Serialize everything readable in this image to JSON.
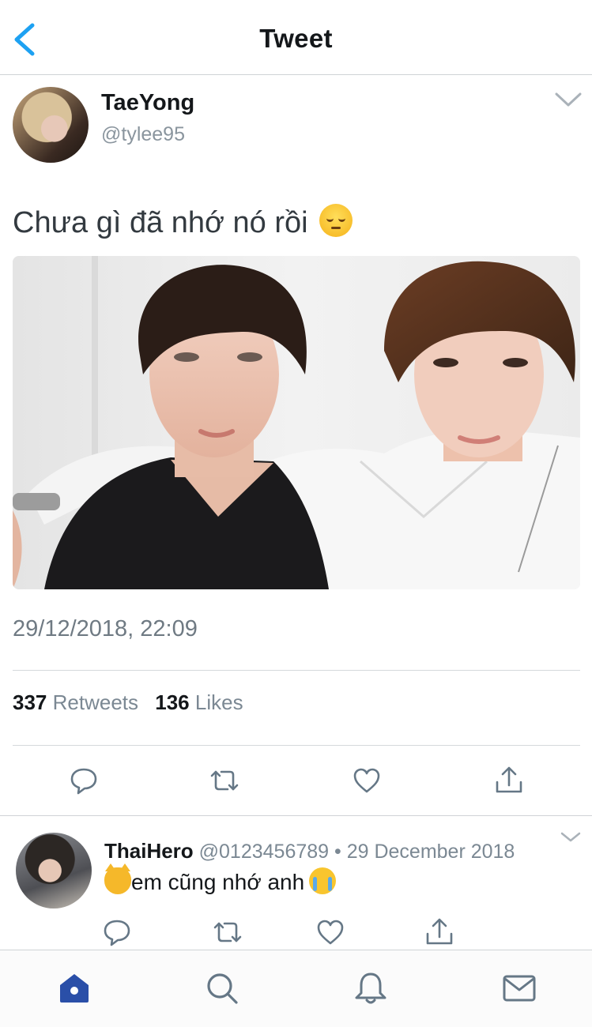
{
  "header": {
    "title": "Tweet"
  },
  "tweet": {
    "author_name": "TaeYong",
    "author_handle": "@tylee95",
    "text": "Chưa gì đã nhớ nó rồi",
    "timestamp": "29/12/2018, 22:09",
    "retweet_count": "337",
    "retweet_label": "Retweets",
    "like_count": "136",
    "like_label": "Likes"
  },
  "reply": {
    "author_name": "ThaiHero",
    "meta": "@0123456789 • 29 December 2018",
    "text": "em cũng nhớ anh"
  },
  "colors": {
    "accent": "#1da1f2",
    "tab_active": "#2a4fa8",
    "icon_gray": "#657786"
  },
  "icons": {
    "back": "chevron-left-icon",
    "caret": "chevron-down-icon",
    "reply": "reply-icon",
    "retweet": "retweet-icon",
    "like": "heart-icon",
    "share": "share-icon",
    "home": "home-icon",
    "search": "search-icon",
    "notifications": "bell-icon",
    "messages": "mail-icon"
  }
}
